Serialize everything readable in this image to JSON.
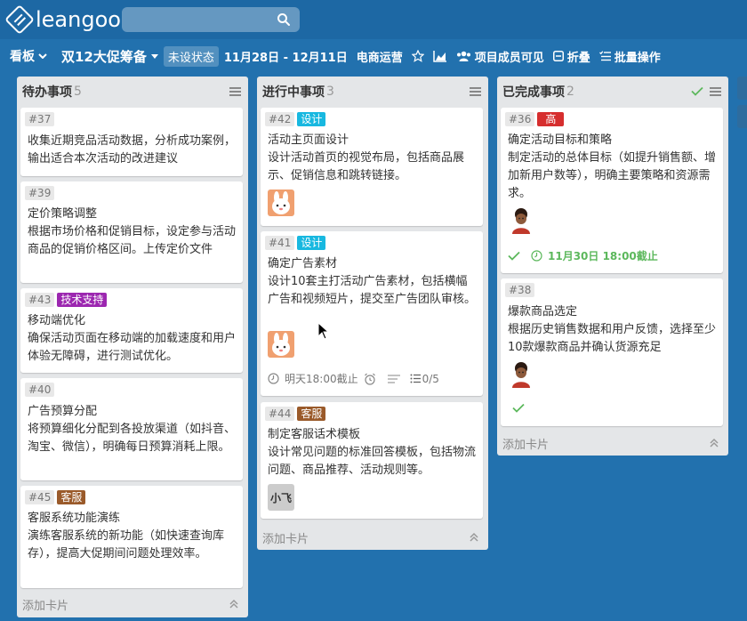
{
  "app": {
    "logo_text": "leangoo"
  },
  "search": {
    "placeholder": ""
  },
  "toolbar": {
    "view_label": "看板",
    "board_name": "双12大促筹备",
    "status": "未设状态",
    "date_range": "11月28日 - 12月11日",
    "team": "电商运营",
    "visibility": "项目成员可见",
    "fold": "折叠",
    "bulk": "批量操作"
  },
  "colors": {
    "tag_design": "#18b8e0",
    "tag_tech": "#9c27b0",
    "tag_service": "#9a5a2a",
    "tag_high": "#d62e2e",
    "done_green": "#5cb85c"
  },
  "lists": [
    {
      "title": "待办事项",
      "count": "5",
      "add_label": "添加卡片",
      "cards": [
        {
          "num": "#37",
          "title": "收集近期竞品活动数据，分析成功案例，输出适合本次活动的改进建议"
        },
        {
          "num": "#39",
          "title": "定价策略调整",
          "desc": "根据市场价格和促销目标，设定参与活动商品的促销价格区间。上传定价文件"
        },
        {
          "num": "#43",
          "tag": "技术支持",
          "title": "移动端优化",
          "desc": "确保活动页面在移动端的加载速度和用户体验无障碍，进行测试优化。"
        },
        {
          "num": "#40",
          "title": "广告预算分配",
          "desc": "将预算细化分配到各投放渠道（如抖音、淘宝、微信），明确每日预算消耗上限。"
        },
        {
          "num": "#45",
          "tag": "客服",
          "title": "客服系统功能演练",
          "desc": "演练客服系统的新功能（如快速查询库存），提高大促期间问题处理效率。"
        }
      ]
    },
    {
      "title": "进行中事项",
      "count": "3",
      "add_label": "添加卡片",
      "cards": [
        {
          "num": "#42",
          "tag": "设计",
          "title": "活动主页面设计",
          "desc": "设计活动首页的视觉布局，包括商品展示、促销信息和跳转链接。",
          "avatar": "bunny"
        },
        {
          "num": "#41",
          "tag": "设计",
          "title": "确定广告素材",
          "desc": "设计10套主打活动广告素材，包括横幅广告和视频短片，提交至广告团队审核。",
          "avatar": "bunny",
          "due": "明天18:00截止",
          "checklist": "0/5"
        },
        {
          "num": "#44",
          "tag": "客服",
          "title": "制定客服话术模板",
          "desc": "设计常见问题的标准回答模板，包括物流问题、商品推荐、活动规则等。",
          "avatar_text": "小飞"
        }
      ]
    },
    {
      "title": "已完成事项",
      "count": "2",
      "add_label": "添加卡片",
      "cards": [
        {
          "num": "#36",
          "tag": "高",
          "title": "确定活动目标和策略",
          "desc": "制定活动的总体目标（如提升销售额、增加新用户数等），明确主要策略和资源需求。",
          "avatar": "person",
          "due": "11月30日 18:00截止"
        },
        {
          "num": "#38",
          "title": "爆款商品选定",
          "desc": "根据历史销售数据和用户反馈，选择至少10款爆款商品并确认货源充足",
          "avatar": "person"
        }
      ]
    }
  ]
}
